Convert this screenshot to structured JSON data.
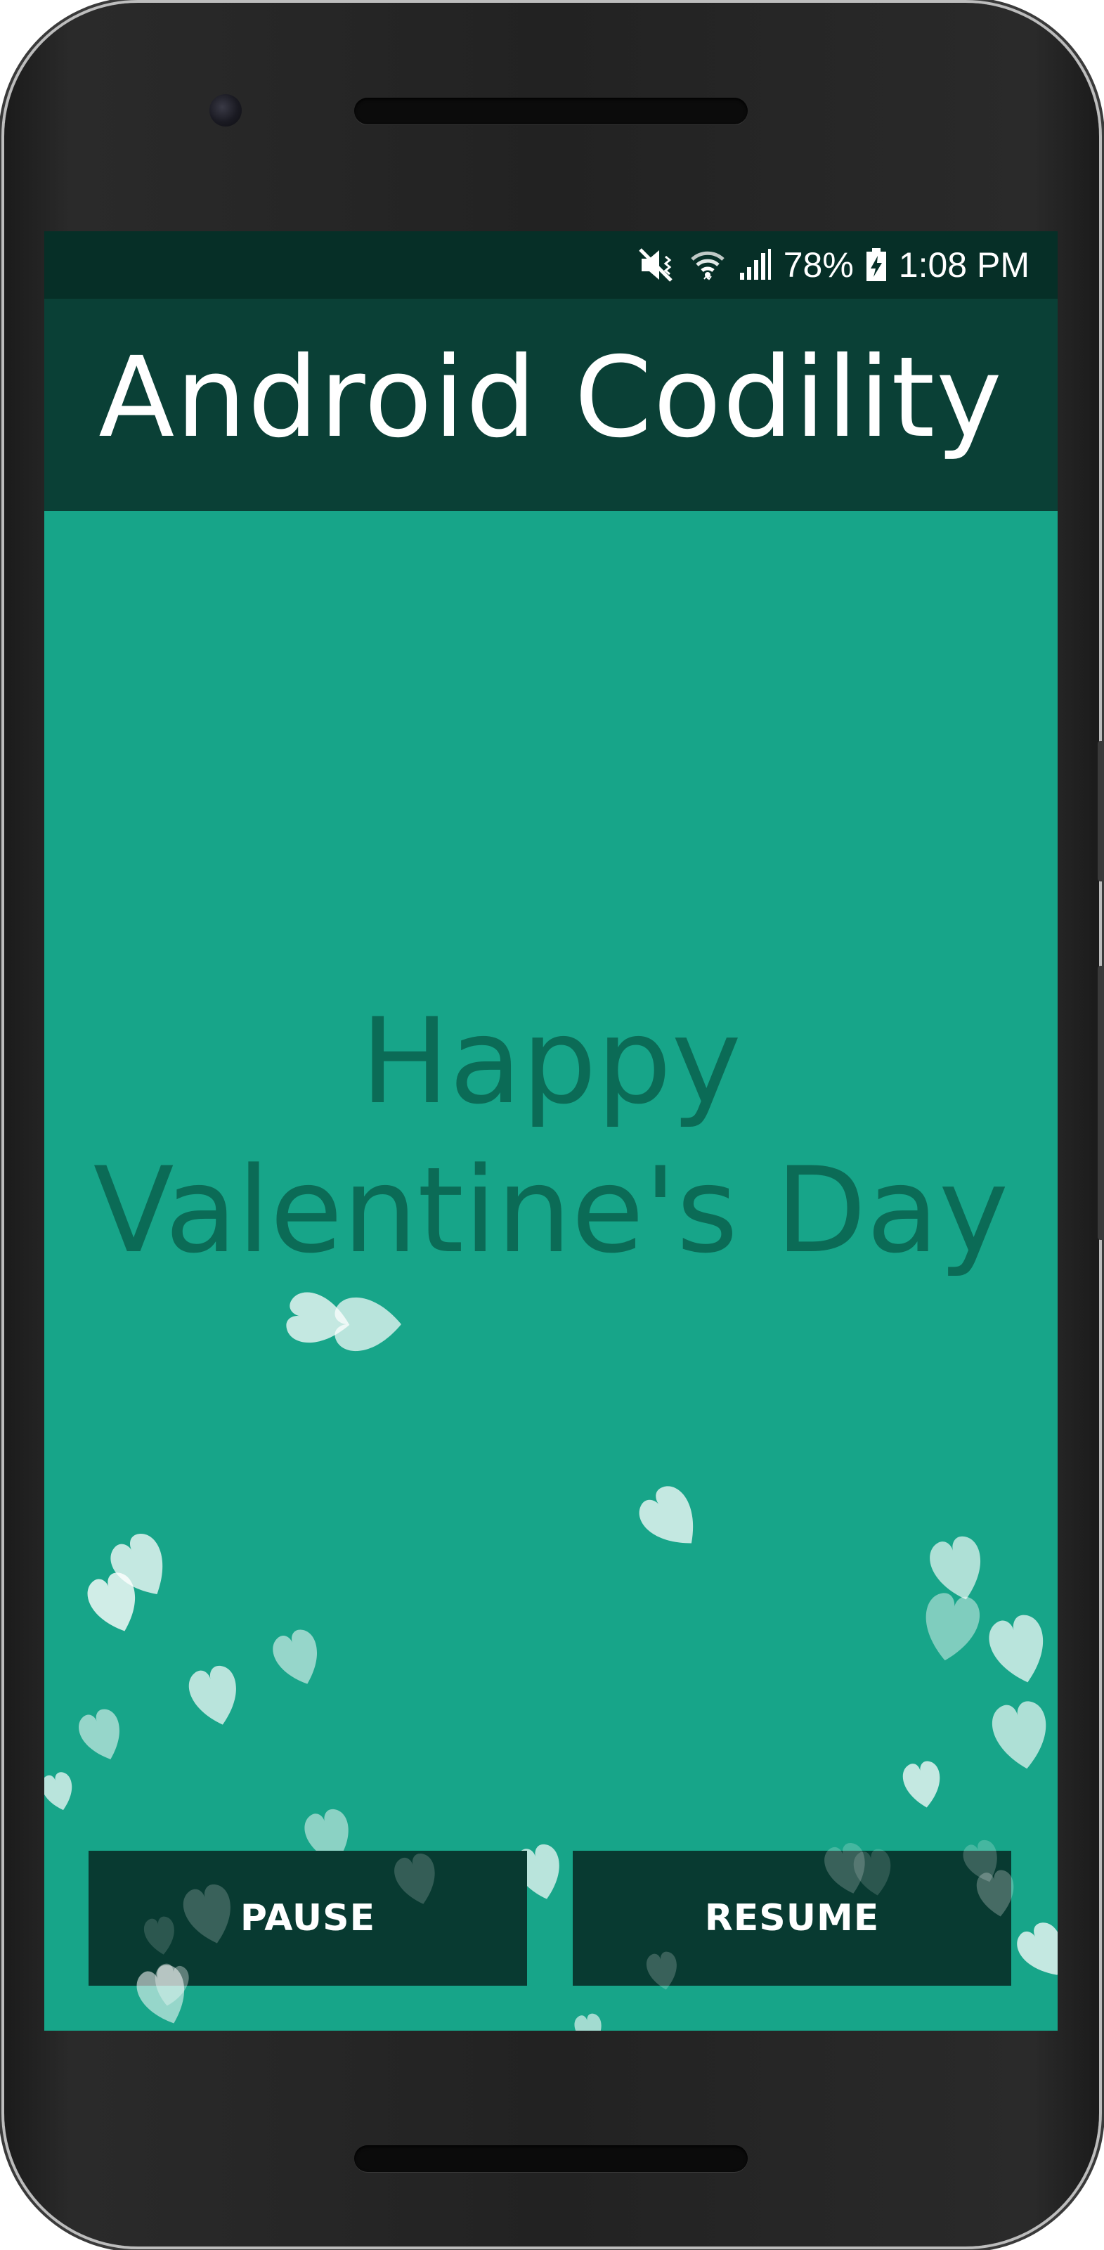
{
  "status_bar": {
    "battery": "78%",
    "time": "1:08 PM",
    "icons": [
      "mute-vibrate-icon",
      "wifi-icon",
      "signal-icon",
      "battery-charging-icon"
    ]
  },
  "app": {
    "title": "Android Codility"
  },
  "main": {
    "greeting": "Happy Valentine's Day"
  },
  "controls": {
    "pause_label": "PAUSE",
    "resume_label": "RESUME"
  },
  "colors": {
    "status_bar": "#062f27",
    "app_bar": "#0a4036",
    "background": "#17a589",
    "greeting_text": "#0b6b56",
    "button": "#083a31",
    "heart": "#ffffff"
  }
}
